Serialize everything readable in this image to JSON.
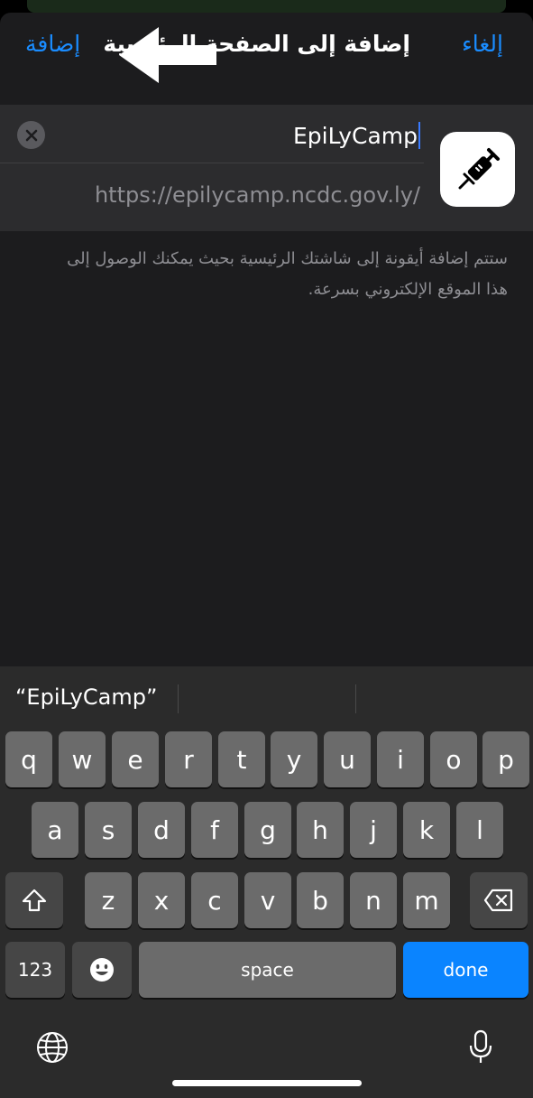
{
  "nav": {
    "add_label": "إضافة",
    "title": "إضافة إلى الصفحة الرئيسية",
    "cancel_label": "إلغاء"
  },
  "bookmark": {
    "name_value": "EpiLyCamp",
    "url": "https://epilycamp.ncdc.gov.ly/",
    "icon": "syringe-icon"
  },
  "description": "ستتم إضافة أيقونة إلى شاشتك الرئيسية بحيث يمكنك الوصول إلى هذا الموقع الإلكتروني بسرعة.",
  "keyboard": {
    "suggestion": "“EpiLyCamp”",
    "row1": [
      "q",
      "w",
      "e",
      "r",
      "t",
      "y",
      "u",
      "i",
      "o",
      "p"
    ],
    "row2": [
      "a",
      "s",
      "d",
      "f",
      "g",
      "h",
      "j",
      "k",
      "l"
    ],
    "row3": [
      "z",
      "x",
      "c",
      "v",
      "b",
      "n",
      "m"
    ],
    "numbers_label": "123",
    "space_label": "space",
    "done_label": "done"
  },
  "colors": {
    "accent": "#1a8cff",
    "sheet_bg": "#1c1c1e",
    "card_bg": "#2c2c2e",
    "key_bg": "#6b6b6b",
    "done_bg": "#0a84ff"
  }
}
